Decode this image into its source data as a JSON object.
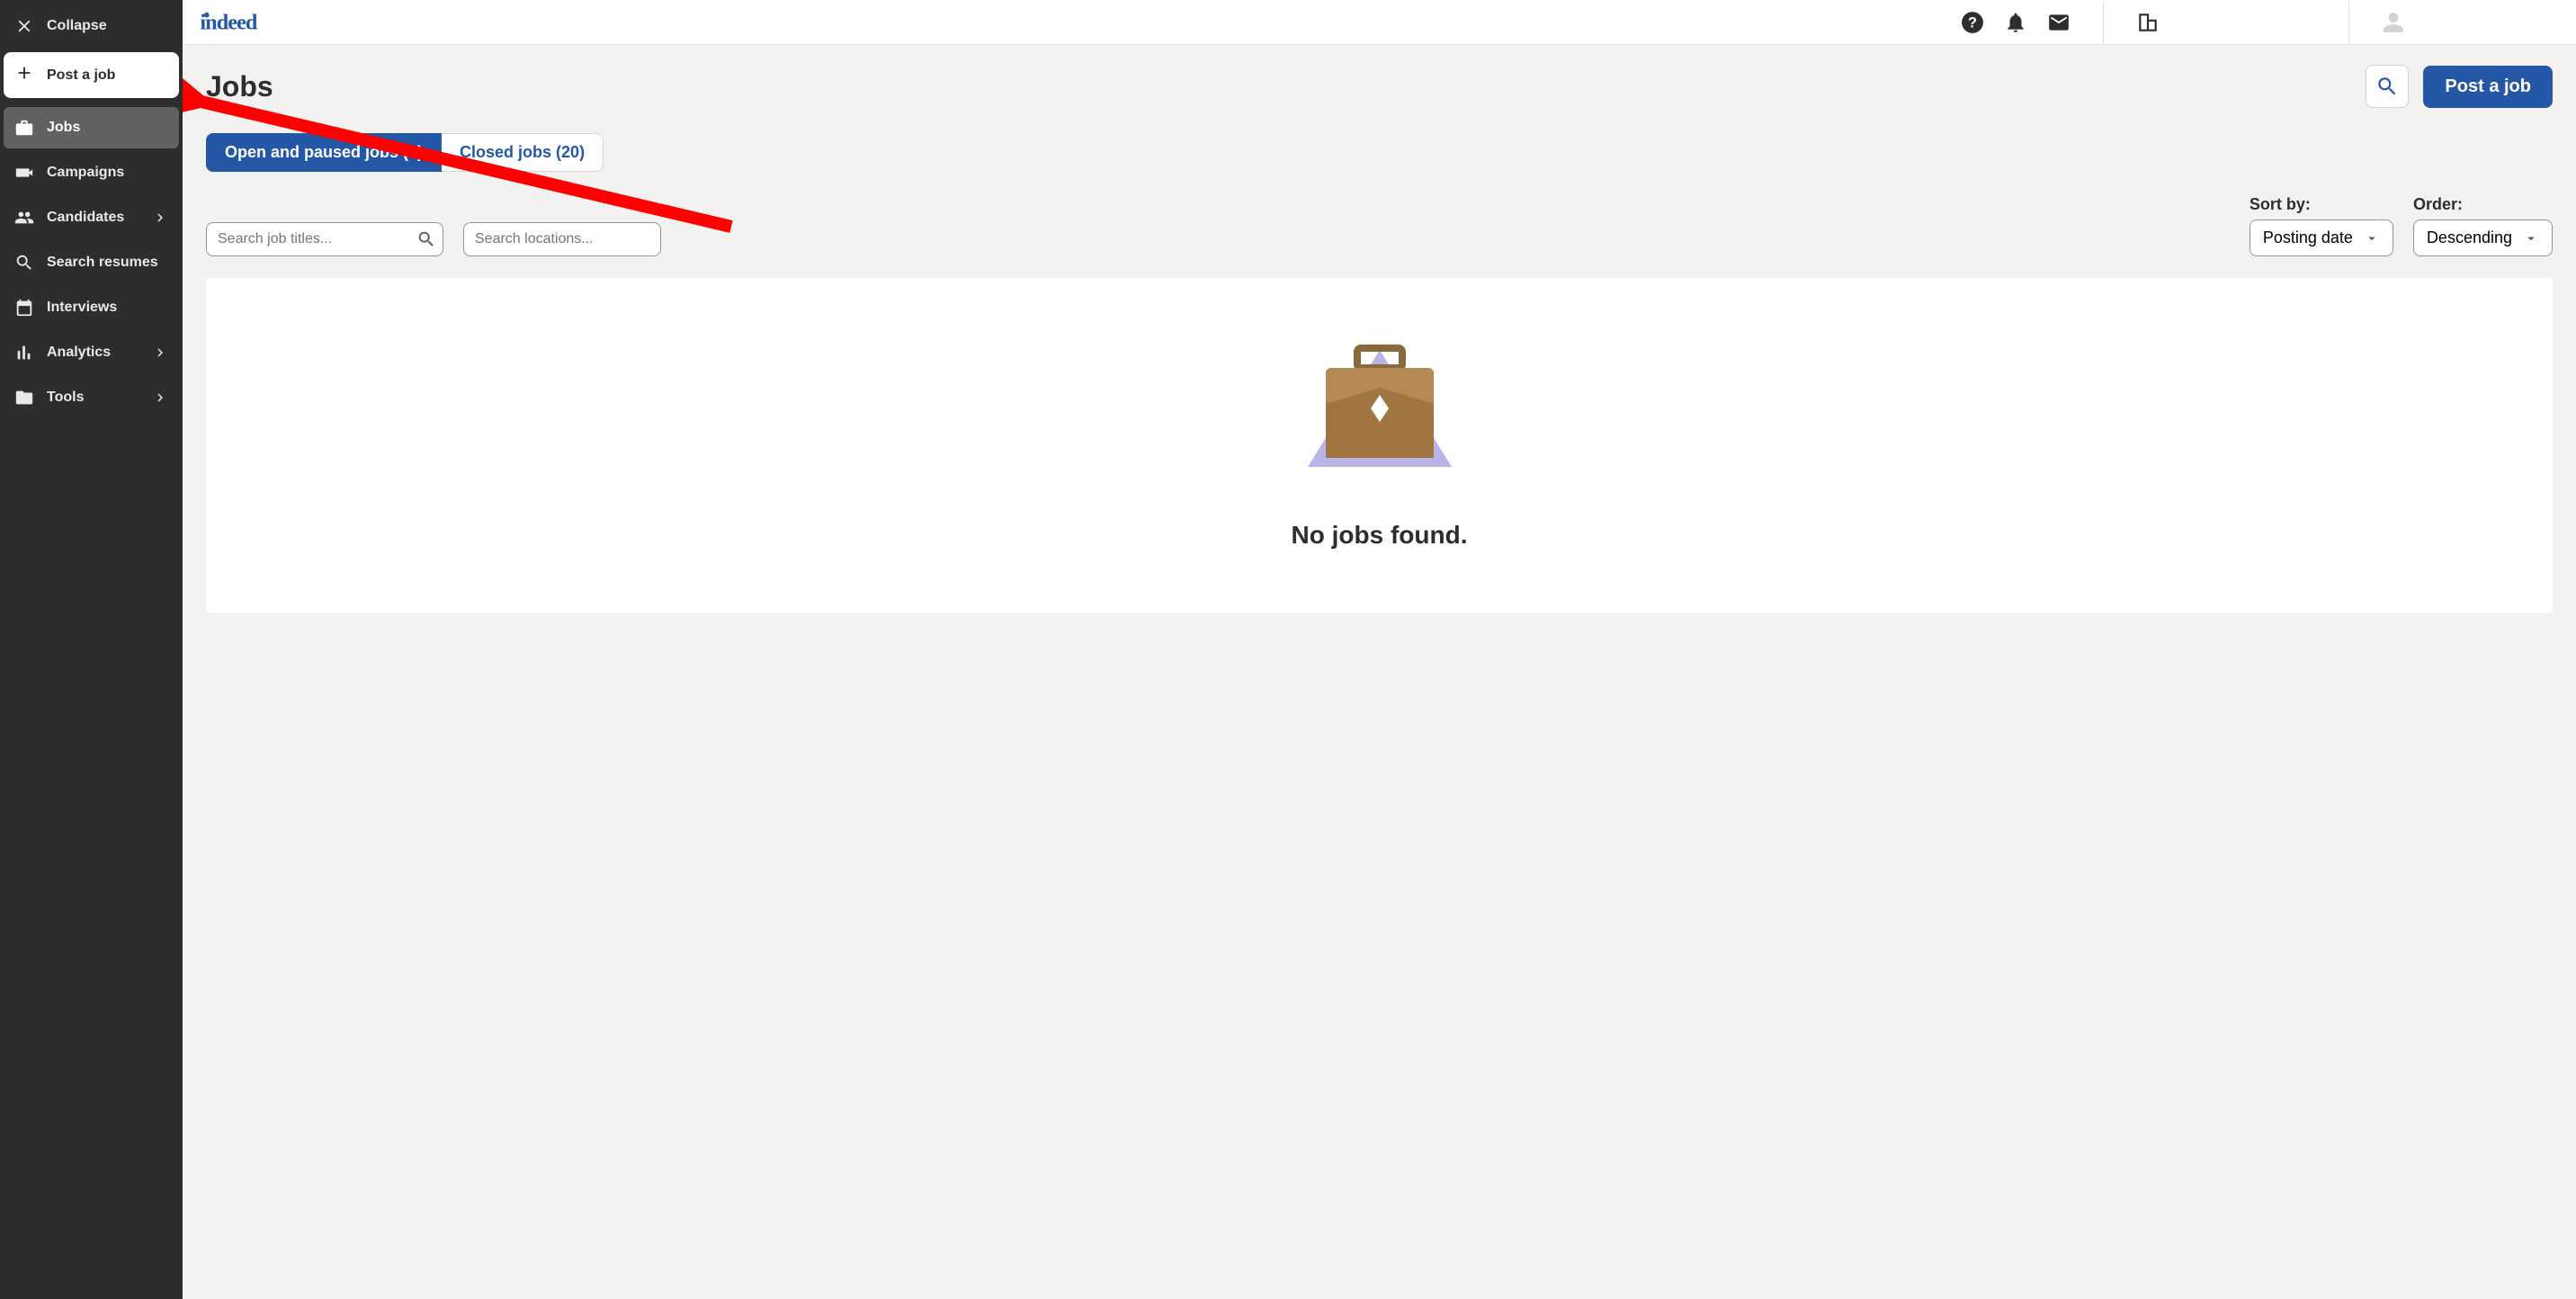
{
  "sidebar": {
    "collapse_label": "Collapse",
    "post_job_label": "Post a job",
    "items": [
      {
        "label": "Jobs",
        "icon": "briefcase-icon",
        "active": true,
        "expandable": false
      },
      {
        "label": "Campaigns",
        "icon": "megaphone-icon",
        "active": false,
        "expandable": false
      },
      {
        "label": "Candidates",
        "icon": "people-icon",
        "active": false,
        "expandable": true
      },
      {
        "label": "Search resumes",
        "icon": "search-doc-icon",
        "active": false,
        "expandable": false
      },
      {
        "label": "Interviews",
        "icon": "calendar-icon",
        "active": false,
        "expandable": false
      },
      {
        "label": "Analytics",
        "icon": "bars-icon",
        "active": false,
        "expandable": true
      },
      {
        "label": "Tools",
        "icon": "folder-icon",
        "active": false,
        "expandable": true
      }
    ]
  },
  "header": {
    "logo_text": "indeed"
  },
  "page": {
    "title": "Jobs",
    "post_job_button": "Post a job"
  },
  "tabs": {
    "open_paused": "Open and paused jobs (0)",
    "closed": "Closed jobs (20)"
  },
  "search": {
    "titles_placeholder": "Search job titles...",
    "locations_placeholder": "Search locations..."
  },
  "sort": {
    "sort_label": "Sort by:",
    "sort_value": "Posting date",
    "order_label": "Order:",
    "order_value": "Descending"
  },
  "empty": {
    "message": "No jobs found."
  }
}
